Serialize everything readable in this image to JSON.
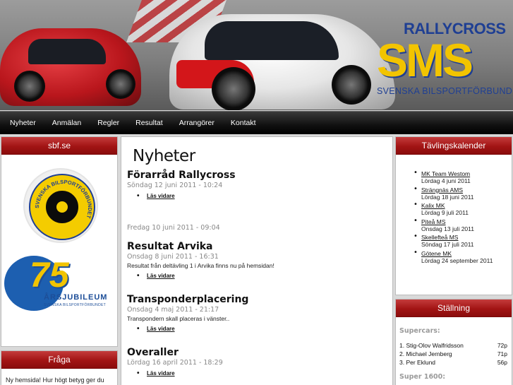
{
  "banner": {
    "logo_top": "RALLYCROSS",
    "logo_main": "SMS",
    "logo_sub": "SVENSKA BILSPORTFÖRBUNDET"
  },
  "nav": {
    "items": [
      "Nyheter",
      "Anmälan",
      "Regler",
      "Resultat",
      "Arrangörer",
      "Kontakt"
    ]
  },
  "left": {
    "box1_title": "sbf.se",
    "sbf_logo_text": "SVENSKA BILSPORTFÖRBUNDET",
    "jubileum_num": "75",
    "jubileum_title": "ÅRSJUBILEUM",
    "jubileum_sub": "SVENSKA BILSPORTFÖRBUNDET",
    "box2_title": "Fråga",
    "box2_text": "Ny hemsida! Hur högt betyg ger du"
  },
  "main": {
    "heading": "Nyheter",
    "posts": [
      {
        "title": "Förarråd Rallycross",
        "date": "Söndag 12 juni 2011 - 10:24",
        "body": "",
        "link": "Läs vidare"
      },
      {
        "title": "",
        "date": "Fredag 10 juni 2011 - 09:04",
        "body": "",
        "link": ""
      },
      {
        "title": "Resultat Arvika",
        "date": "Onsdag 8 juni 2011 - 16:31",
        "body": "Resultat från deltävling 1 i Arvika finns nu på hemsidan!",
        "link": "Läs vidare"
      },
      {
        "title": "Transponderplacering",
        "date": "Onsdag 4 maj 2011 - 21:17",
        "body": "Transpondern skall placeras i vänster..",
        "link": "Läs vidare"
      },
      {
        "title": "Overaller",
        "date": "Lördag 16 april 2011 - 18:29",
        "body": "",
        "link": "Läs vidare"
      }
    ]
  },
  "right": {
    "calendar_title": "Tävlingskalender",
    "events": [
      {
        "name": "MK Team Westom",
        "date": "Lördag 4 juni 2011"
      },
      {
        "name": "Strängnäs AMS",
        "date": "Lördag 18 juni 2011"
      },
      {
        "name": "Kalix MK",
        "date": "Lördag 9 juli 2011"
      },
      {
        "name": "Piteå MS",
        "date": "Onsdag 13 juli 2011"
      },
      {
        "name": "Skellefteå MS",
        "date": "Söndag 17 juli 2011"
      },
      {
        "name": "Götene MK",
        "date": "Lördag 24 september 2011"
      }
    ],
    "standings_title": "Ställning",
    "supercars_label": "Supercars:",
    "supercars": [
      {
        "pos": "1. Stig-Olov Walfridsson",
        "pts": "72p"
      },
      {
        "pos": "2. Michael Jernberg",
        "pts": "71p"
      },
      {
        "pos": "3. Per Eklund",
        "pts": "56p"
      }
    ],
    "super1600_label": "Super 1600:"
  },
  "colors": {
    "accent_red": "#a21414",
    "brand_blue": "#1f3f93",
    "brand_yellow": "#f2c400"
  }
}
